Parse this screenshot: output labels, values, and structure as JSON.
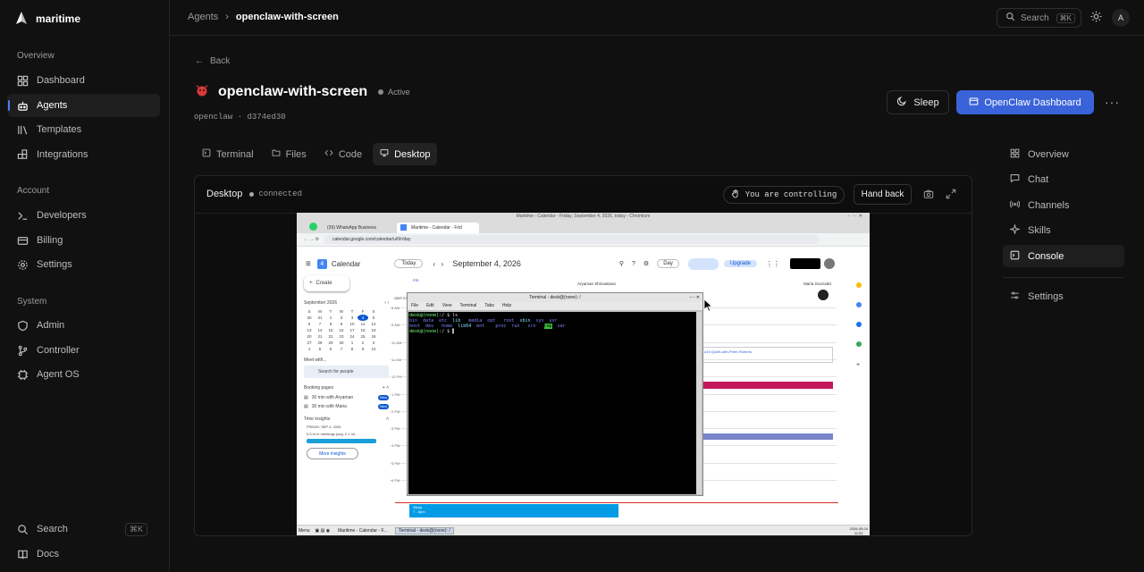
{
  "brand": {
    "name": "maritime"
  },
  "sidebar": {
    "sections": [
      {
        "label": "Overview",
        "items": [
          {
            "label": "Dashboard",
            "icon": "grid-icon"
          },
          {
            "label": "Agents",
            "icon": "robot-icon",
            "active": true
          },
          {
            "label": "Templates",
            "icon": "library-icon"
          },
          {
            "label": "Integrations",
            "icon": "blocks-icon"
          }
        ]
      },
      {
        "label": "Account",
        "items": [
          {
            "label": "Developers",
            "icon": "terminal-icon"
          },
          {
            "label": "Billing",
            "icon": "card-icon"
          },
          {
            "label": "Settings",
            "icon": "gear-icon"
          }
        ]
      },
      {
        "label": "System",
        "items": [
          {
            "label": "Admin",
            "icon": "shield-icon"
          },
          {
            "label": "Controller",
            "icon": "git-icon"
          },
          {
            "label": "Agent OS",
            "icon": "cpu-icon"
          }
        ]
      }
    ],
    "footer": [
      {
        "label": "Search",
        "shortcut": "⌘K"
      },
      {
        "label": "Docs"
      }
    ]
  },
  "topbar": {
    "breadcrumb": [
      "Agents",
      "openclaw-with-screen"
    ],
    "search_placeholder": "Search",
    "search_shortcut": "⌘K",
    "avatar_initial": "A"
  },
  "agent": {
    "back_label": "Back",
    "name": "openclaw-with-screen",
    "status": "Active",
    "meta_type": "openclaw",
    "meta_sep": "·",
    "meta_id": "d374ed30",
    "sleep_label": "Sleep",
    "dashboard_label": "OpenClaw Dashboard",
    "accent": "#3b63d9"
  },
  "tabs": [
    "Terminal",
    "Files",
    "Code",
    "Desktop"
  ],
  "active_tab": "Desktop",
  "desktop_panel": {
    "title": "Desktop",
    "connection": "connected",
    "controlling_label": "You are controlling",
    "handback_label": "Hand back"
  },
  "right_nav": {
    "items": [
      "Overview",
      "Chat",
      "Channels",
      "Skills",
      "Console"
    ],
    "active": "Console",
    "settings": "Settings"
  },
  "screen": {
    "window_title": "Maritime - Calendar - Friday, September 4, 2026, today - Chromium",
    "browser_tabs": [
      "(39) WhatsApp Business",
      "Maritime - Calendar - Frid"
    ],
    "url": "calendar.google.com/calendar/u/0/r/day",
    "calendar": {
      "app": "Calendar",
      "today_btn": "Today",
      "date": "September 4, 2026",
      "view": "Day",
      "upgrade": "Upgrade",
      "create": "Create",
      "mini_month": "September 2026",
      "weekdays": [
        "S",
        "M",
        "T",
        "W",
        "T",
        "F",
        "S"
      ],
      "weeks": [
        [
          "30",
          "31",
          "1",
          "2",
          "3",
          "4",
          "5"
        ],
        [
          "6",
          "7",
          "8",
          "9",
          "10",
          "11",
          "12"
        ],
        [
          "13",
          "14",
          "15",
          "16",
          "17",
          "18",
          "19"
        ],
        [
          "20",
          "21",
          "22",
          "23",
          "24",
          "25",
          "26"
        ],
        [
          "27",
          "28",
          "29",
          "30",
          "1",
          "2",
          "3"
        ],
        [
          "4",
          "5",
          "6",
          "7",
          "8",
          "9",
          "10"
        ]
      ],
      "meet_with": "Meet with...",
      "search_people": "Search for people",
      "booking_pages": "Booking pages",
      "bookings": [
        "30 min with Aryaman",
        "30 min with Maria"
      ],
      "new_badge": "New",
      "time_insights": "Time insights",
      "insight_date": "FRIDAY, SEP 4, 2026",
      "insight_text": "0.5 hr in meetings (avg: 2.1 hr)",
      "more_insights": "More insights",
      "day_label": "FRI",
      "day_num": "4",
      "timezone": "GMT-07",
      "hours": [
        "8 AM",
        "9 AM",
        "10 AM",
        "11 AM",
        "12 PM",
        "1 PM",
        "2 PM",
        "3 PM",
        "4 PM",
        "5 PM",
        "6 PM"
      ],
      "people": [
        "Aryaman Shrivastava",
        "Maria Gonzalez"
      ],
      "event_line": "a19-QdzN-with-Peter-Roberts",
      "event_block": "Sleep\n7 - 8pm"
    },
    "terminal": {
      "title": "Terminal - desk@(none): /",
      "menu": [
        "File",
        "Edit",
        "View",
        "Terminal",
        "Tabs",
        "Help"
      ],
      "lines": [
        [
          {
            "t": "desk@(none)",
            "c": "#7fff7f"
          },
          {
            "t": ":/ $ ls",
            "c": "#ddd"
          }
        ],
        [
          {
            "t": "bin",
            "c": "#8080ff"
          },
          {
            "t": "  data  etc  ",
            "c": "#8080ff"
          },
          {
            "t": "lib",
            "c": "#80e0ff"
          },
          {
            "t": "   media  opt   root  ",
            "c": "#8080ff"
          },
          {
            "t": "sbin",
            "c": "#80e0ff"
          },
          {
            "t": "  sys  usr",
            "c": "#8080ff"
          }
        ],
        [
          {
            "t": "boot  dev   home  ",
            "c": "#8080ff"
          },
          {
            "t": "lib64",
            "c": "#80e0ff"
          },
          {
            "t": "  mnt    proc  run   srv   ",
            "c": "#8080ff"
          },
          {
            "t": "tmp",
            "c": "#000",
            "bg": "#40c040"
          },
          {
            "t": "  var",
            "c": "#8080ff"
          }
        ],
        [
          {
            "t": "desk@(none)",
            "c": "#7fff7f"
          },
          {
            "t": ":/ $ ",
            "c": "#ddd"
          },
          {
            "t": "▌",
            "c": "#ddd"
          }
        ]
      ]
    },
    "taskbar": [
      "Menu",
      "Maritime - Calendar - F...",
      "Terminal - desk@(none): /"
    ],
    "clock": [
      "2026-09-04",
      "11:51"
    ]
  }
}
